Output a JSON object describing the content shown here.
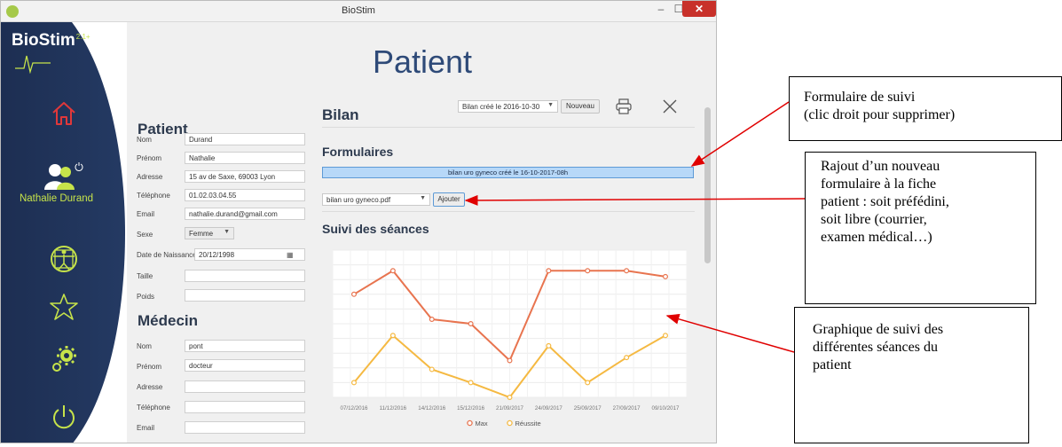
{
  "window": {
    "title": "BioStim"
  },
  "sidebar": {
    "logo": {
      "name": "BioStim",
      "version": "2.1+"
    },
    "patient_name": "Nathalie Durand"
  },
  "page": {
    "title": "Patient"
  },
  "patient": {
    "heading": "Patient",
    "fields": {
      "nom": {
        "label": "Nom",
        "value": "Durand"
      },
      "prenom": {
        "label": "Prénom",
        "value": "Nathalie"
      },
      "adresse": {
        "label": "Adresse",
        "value": "15 av de Saxe, 69003 Lyon"
      },
      "telephone": {
        "label": "Téléphone",
        "value": "01.02.03.04.55"
      },
      "email": {
        "label": "Email",
        "value": "nathalie.durand@gmail.com"
      },
      "sexe": {
        "label": "Sexe",
        "value": "Femme"
      },
      "naissance": {
        "label": "Date de Naissance",
        "value": "20/12/1998"
      },
      "taille": {
        "label": "Taille",
        "value": ""
      },
      "poids": {
        "label": "Poids",
        "value": ""
      }
    }
  },
  "medecin": {
    "heading": "Médecin",
    "fields": {
      "nom": {
        "label": "Nom",
        "value": "pont"
      },
      "prenom": {
        "label": "Prénom",
        "value": "docteur"
      },
      "adresse": {
        "label": "Adresse",
        "value": ""
      },
      "telephone": {
        "label": "Téléphone",
        "value": ""
      },
      "email": {
        "label": "Email",
        "value": ""
      }
    }
  },
  "bilan": {
    "heading": "Bilan",
    "selected": "Bilan créé le 2016-10-30",
    "new_button": "Nouveau",
    "formulaires_heading": "Formulaires",
    "form_row": "bilan uro gyneco créé le 16-10-2017-08h",
    "form_select": "bilan uro gyneco.pdf",
    "add_button": "Ajouter",
    "suivi_heading": "Suivi des séances"
  },
  "chart_data": {
    "type": "line",
    "categories": [
      "07/12/2016",
      "11/12/2016",
      "14/12/2016",
      "15/12/2016",
      "21/09/2017",
      "24/09/2017",
      "25/09/2017",
      "27/09/2017",
      "09/10/2017"
    ],
    "series": [
      {
        "name": "Max",
        "color": "#e8744f",
        "values": [
          70,
          86,
          53,
          50,
          25,
          86,
          86,
          86,
          82
        ]
      },
      {
        "name": "Réussite",
        "color": "#f5b942",
        "values": [
          10,
          42,
          19,
          10,
          0,
          35,
          10,
          27,
          42
        ]
      }
    ],
    "ylim": [
      0,
      100
    ],
    "grid": true,
    "legend": "bottom"
  },
  "annotations": {
    "note1": [
      "Formulaire de suivi",
      "(clic droit pour supprimer)"
    ],
    "note2": [
      "Rajout d’un nouveau",
      "formulaire à la fiche",
      "patient : soit préfédini,",
      "soit libre (courrier,",
      "examen médical…)"
    ],
    "note3": [
      "Graphique de suivi des",
      "différentes séances du",
      "patient"
    ]
  }
}
